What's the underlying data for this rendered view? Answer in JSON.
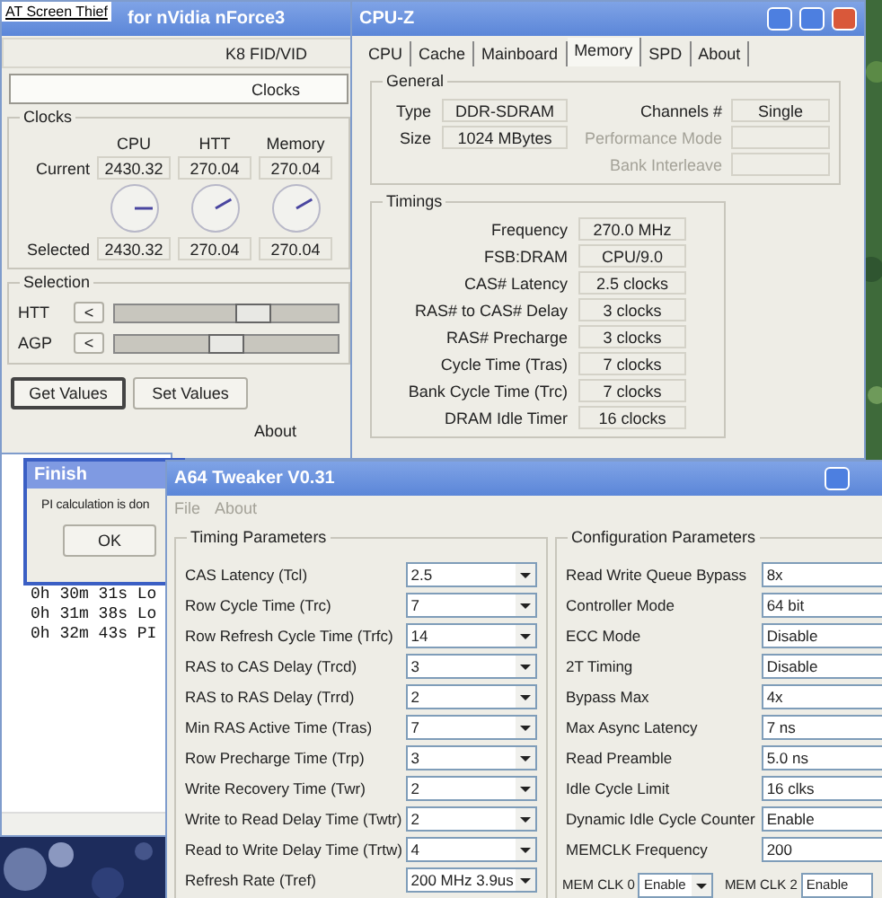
{
  "clock_window": {
    "overlay_label": "AT Screen Thief",
    "title": "for nVidia nForce3",
    "tabs": [
      {
        "label": "K8 FID/VID",
        "selected": false
      },
      {
        "label": "Clocks",
        "selected": true
      }
    ],
    "clocks": {
      "title": "Clocks",
      "columns": [
        "CPU",
        "HTT",
        "Memory"
      ],
      "rows": [
        {
          "label": "Current",
          "values": [
            "2430.32",
            "270.04",
            "270.04"
          ]
        },
        {
          "label": "Selected",
          "values": [
            "2430.32",
            "270.04",
            "270.04"
          ]
        }
      ]
    },
    "selection": {
      "title": "Selection",
      "sliders": [
        {
          "label": "HTT",
          "button": "<",
          "level": 0.62
        },
        {
          "label": "AGP",
          "button": "<",
          "level": 0.5
        }
      ]
    },
    "buttons": [
      {
        "label": "Get Values",
        "focused": true
      },
      {
        "label": "Set Values",
        "focused": false
      }
    ],
    "about": "About"
  },
  "cpuz": {
    "title": "CPU-Z",
    "tabs": [
      {
        "label": "CPU",
        "selected": false
      },
      {
        "label": "Cache",
        "selected": false
      },
      {
        "label": "Mainboard",
        "selected": false
      },
      {
        "label": "Memory",
        "selected": true
      },
      {
        "label": "SPD",
        "selected": false
      },
      {
        "label": "About",
        "selected": false
      }
    ],
    "general": {
      "title": "General",
      "left": [
        {
          "label": "Type",
          "value": "DDR-SDRAM"
        },
        {
          "label": "Size",
          "value": "1024 MBytes"
        }
      ],
      "right": [
        {
          "label": "Channels #",
          "value": "Single",
          "disabled": false
        },
        {
          "label": "Performance Mode",
          "disabled": true
        },
        {
          "label": "Bank Interleave",
          "disabled": true
        }
      ]
    },
    "timings": {
      "title": "Timings",
      "rows": [
        {
          "label": "Frequency",
          "value": "270.0 MHz"
        },
        {
          "label": "FSB:DRAM",
          "value": "CPU/9.0"
        },
        {
          "label": "CAS# Latency",
          "value": "2.5 clocks"
        },
        {
          "label": "RAS# to CAS# Delay",
          "value": "3 clocks"
        },
        {
          "label": "RAS# Precharge",
          "value": "3 clocks"
        },
        {
          "label": "Cycle Time (Tras)",
          "value": "7 clocks"
        },
        {
          "label": "Bank Cycle Time (Trc)",
          "value": "7 clocks"
        },
        {
          "label": "DRAM Idle Timer",
          "value": "16 clocks"
        }
      ]
    }
  },
  "log_window": {
    "lines": [
      "0h 30m 31s Lo",
      "0h 31m 38s Lo",
      "0h 32m 43s PI"
    ]
  },
  "finish_dialog": {
    "title": "Finish",
    "message": "PI calculation is don",
    "button": "OK"
  },
  "tweaker": {
    "title": "A64 Tweaker V0.31",
    "menu": [
      {
        "label": "File",
        "disabled": true
      },
      {
        "label": "About",
        "disabled": true
      }
    ],
    "timing": {
      "title": "Timing Parameters",
      "rows": [
        {
          "label": "CAS Latency (Tcl)",
          "value": "2.5"
        },
        {
          "label": "Row Cycle Time (Trc)",
          "value": "7"
        },
        {
          "label": "Row Refresh Cycle Time (Trfc)",
          "value": "14"
        },
        {
          "label": "RAS to CAS Delay (Trcd)",
          "value": "3"
        },
        {
          "label": "RAS to RAS Delay (Trrd)",
          "value": "2"
        },
        {
          "label": "Min RAS Active Time (Tras)",
          "value": "7"
        },
        {
          "label": "Row Precharge Time (Trp)",
          "value": "3"
        },
        {
          "label": "Write Recovery Time (Twr)",
          "value": "2"
        },
        {
          "label": "Write to Read Delay Time (Twtr)",
          "value": "2"
        },
        {
          "label": "Read to Write Delay Time (Trtw)",
          "value": "4"
        },
        {
          "label": "Refresh Rate (Tref)",
          "value": "200 MHz 3.9us"
        }
      ]
    },
    "config": {
      "title": "Configuration Parameters",
      "rows": [
        {
          "label": "Read Write Queue Bypass",
          "value": "8x"
        },
        {
          "label": "Controller Mode",
          "value": "64 bit"
        },
        {
          "label": "ECC Mode",
          "value": "Disable"
        },
        {
          "label": "2T Timing",
          "value": "Disable"
        },
        {
          "label": "Bypass Max",
          "value": "4x"
        },
        {
          "label": "Max Async Latency",
          "value": "7 ns"
        },
        {
          "label": "Read Preamble",
          "value": "5.0 ns"
        },
        {
          "label": "Idle Cycle Limit",
          "value": "16 clks"
        },
        {
          "label": "Dynamic Idle Cycle Counter",
          "value": "Enable"
        },
        {
          "label": "MEMCLK Frequency",
          "value": "200"
        }
      ]
    },
    "mem_clk": [
      {
        "label": "MEM CLK 0",
        "value": "Enable"
      },
      {
        "label": "MEM CLK 2",
        "value": "Enable"
      }
    ]
  }
}
